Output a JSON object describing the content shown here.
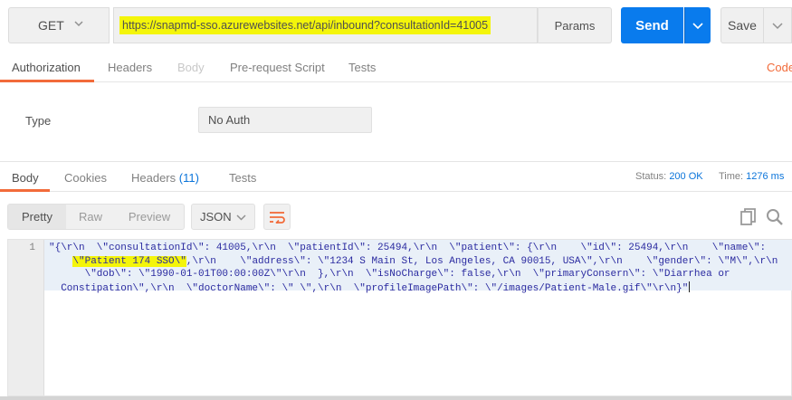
{
  "request": {
    "method": "GET",
    "url": "https://snapmd-sso.azurewebsites.net/api/inbound?consultationId=41005",
    "params_label": "Params",
    "send_label": "Send",
    "save_label": "Save"
  },
  "request_tabs": {
    "authorization": "Authorization",
    "headers": "Headers",
    "body": "Body",
    "prerequest": "Pre-request Script",
    "tests": "Tests",
    "code": "Code"
  },
  "auth": {
    "type_label": "Type",
    "type_value": "No Auth"
  },
  "response_tabs": {
    "body": "Body",
    "cookies": "Cookies",
    "headers": "Headers",
    "headers_count": "(11)",
    "tests": "Tests"
  },
  "response_status": {
    "status_label": "Status:",
    "status_value": "200 OK",
    "time_label": "Time:",
    "time_value": "1276 ms"
  },
  "response_view": {
    "pretty": "Pretty",
    "raw": "Raw",
    "preview": "Preview",
    "format": "JSON"
  },
  "response_body": {
    "line_number": "1",
    "line1": "\"{\\r\\n  \\\"consultationId\\\": 41005,\\r\\n  \\\"patientId\\\": 25494,\\r\\n  \\\"patient\\\": {\\r\\n    \\\"id\\\": 25494,\\r\\n    \\\"name\\\":",
    "line2_indent": "    ",
    "line2_highlight": "\\\"Patient 174 SSO\\\"",
    "line2_rest": ",\\r\\n    \\\"address\\\": \\\"1234 S Main St, Los Angeles, CA 90015, USA\\\",\\r\\n    \\\"gender\\\": \\\"M\\\",\\r\\n",
    "line3": "      \\\"dob\\\": \\\"1990-01-01T00:00:00Z\\\"\\r\\n  },\\r\\n  \\\"isNoCharge\\\": false,\\r\\n  \\\"primaryConsern\\\": \\\"Diarrhea or",
    "line4": "  Constipation\\\",\\r\\n  \\\"doctorName\\\": \\\" \\\",\\r\\n  \\\"profileImagePath\\\": \\\"/images/Patient-Male.gif\\\"\\r\\n}\""
  },
  "colors": {
    "accent": "#f26b3a",
    "send": "#097bed",
    "highlight": "#f4f50a",
    "link": "#0a74da"
  }
}
